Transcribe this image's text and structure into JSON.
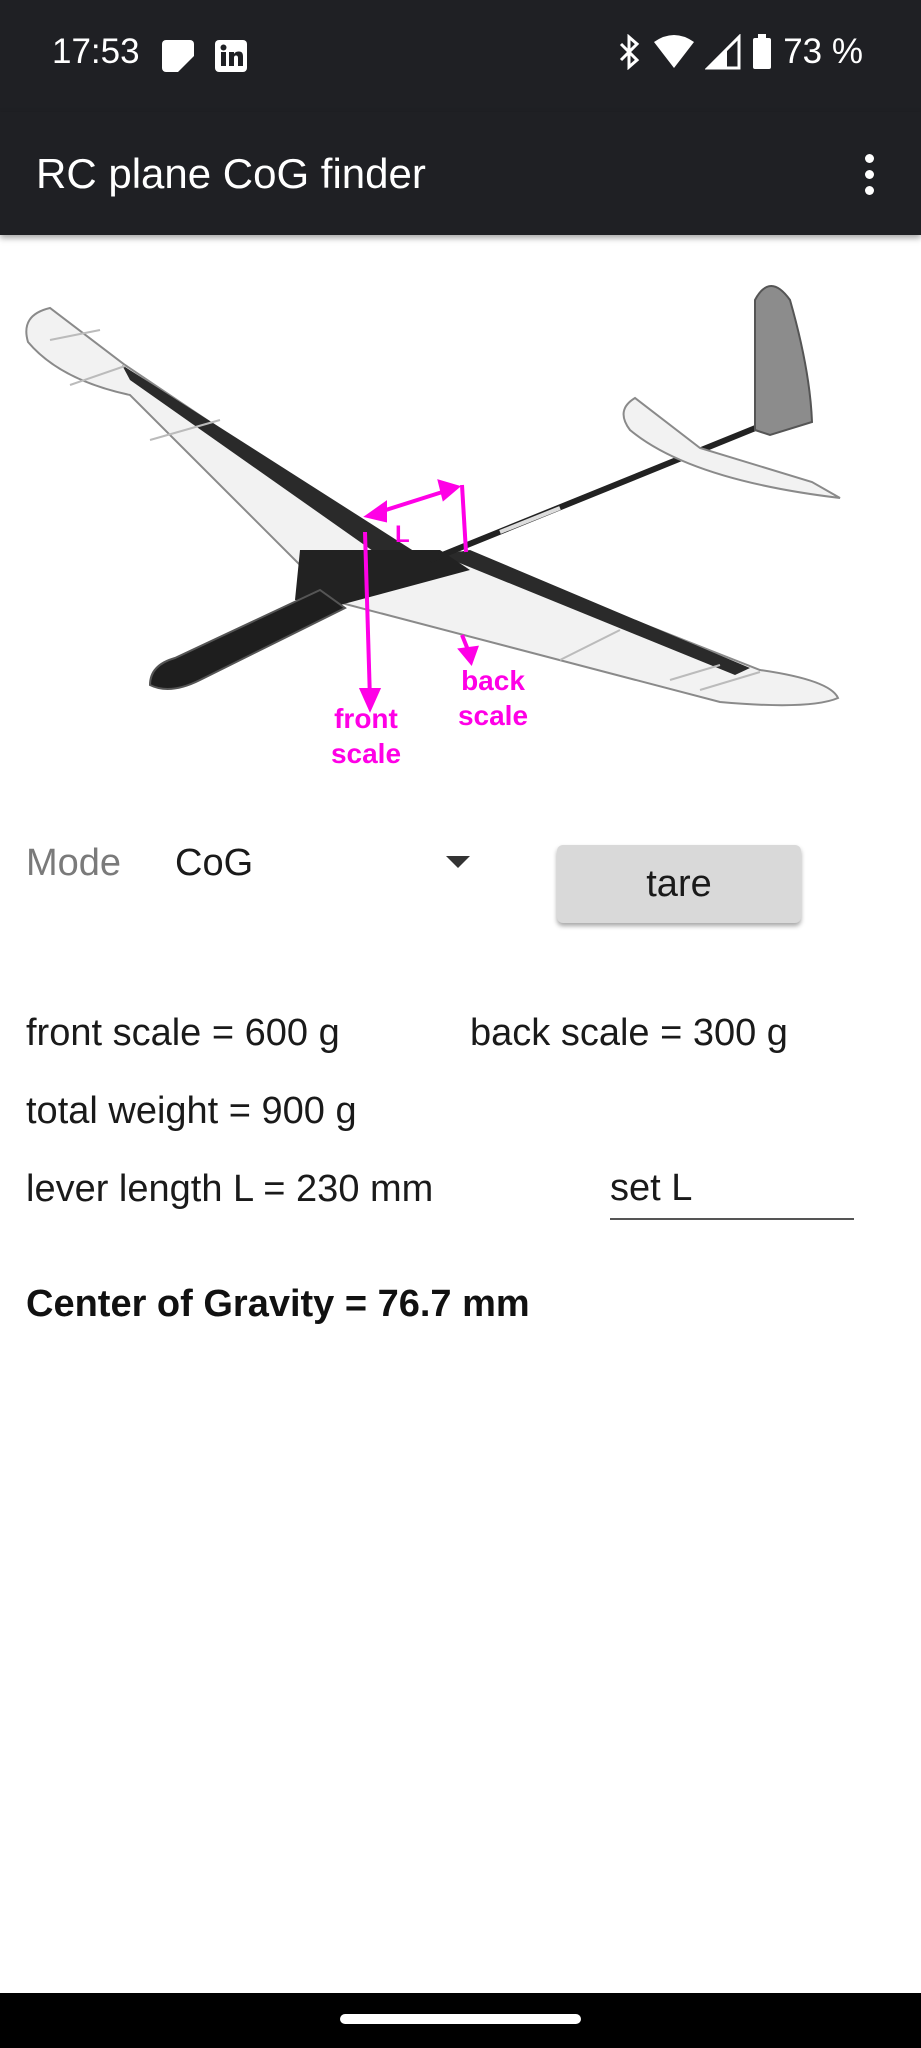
{
  "status_bar": {
    "time": "17:53",
    "battery_text": "73 %",
    "icons": [
      "notes-icon",
      "linkedin-icon",
      "bluetooth-icon",
      "wifi-icon",
      "cell-signal-icon",
      "battery-icon"
    ]
  },
  "app_bar": {
    "title": "RC plane CoG finder",
    "menu_icon": "more-vert-icon"
  },
  "diagram": {
    "label_L": "L",
    "label_front_1": "front",
    "label_front_2": "scale",
    "label_back_1": "back",
    "label_back_2": "scale",
    "accent_color": "#ff00e6"
  },
  "controls": {
    "mode_label": "Mode",
    "mode_value": "CoG",
    "tare_label": "tare",
    "set_L_placeholder": "set L"
  },
  "readings": {
    "front_scale": "front scale = 600 g",
    "back_scale": "back scale = 300 g",
    "total_weight": "total weight = 900 g",
    "lever_length": "lever length L = 230 mm",
    "center_of_gravity": "Center of Gravity = 76.7 mm"
  }
}
